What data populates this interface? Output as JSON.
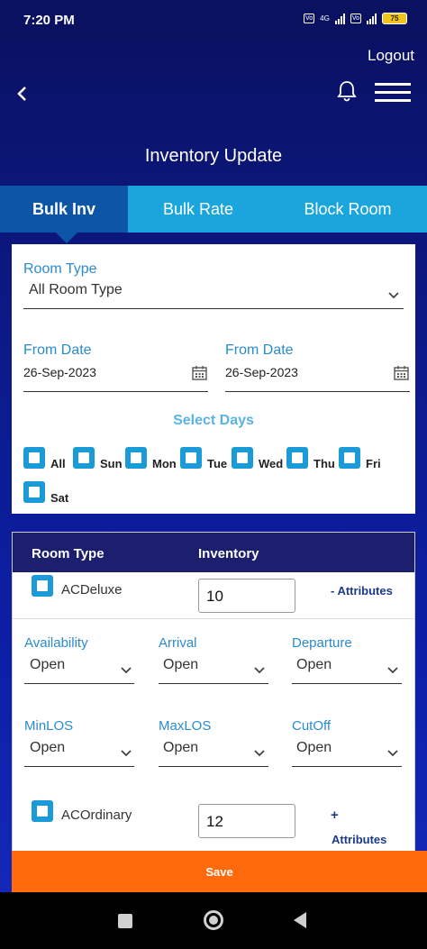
{
  "status_bar": {
    "time": "7:20 PM",
    "network": "4G",
    "battery": "75"
  },
  "header": {
    "logout_label": "Logout",
    "title": "Inventory Update"
  },
  "tabs": [
    {
      "label": "Bulk Inv",
      "active": true
    },
    {
      "label": "Bulk Rate",
      "active": false
    },
    {
      "label": "Block Room",
      "active": false
    }
  ],
  "filters": {
    "room_type_label": "Room Type",
    "room_type_value": "All Room Type",
    "from_date_label": "From Date",
    "from_date_value": "26-Sep-2023",
    "to_date_label": "From Date",
    "to_date_value": "26-Sep-2023",
    "select_days_label": "Select Days",
    "days": [
      "All",
      "Sun",
      "Mon",
      "Tue",
      "Wed",
      "Thu",
      "Fri",
      "Sat"
    ]
  },
  "table": {
    "headers": {
      "room_type": "Room Type",
      "inventory": "Inventory"
    },
    "rows": [
      {
        "name": "ACDeluxe",
        "inventory": "10",
        "attributes_label": "- Attributes",
        "attributes": {
          "availability": {
            "label": "Availability",
            "value": "Open"
          },
          "arrival": {
            "label": "Arrival",
            "value": "Open"
          },
          "departure": {
            "label": "Departure",
            "value": "Open"
          },
          "minlos": {
            "label": "MinLOS",
            "value": "Open"
          },
          "maxlos": {
            "label": "MaxLOS",
            "value": "Open"
          },
          "cutoff": {
            "label": "CutOff",
            "value": "Open"
          }
        }
      },
      {
        "name": "ACOrdinary",
        "inventory": "12",
        "attributes_plus": "+",
        "attributes_label": "Attributes"
      }
    ]
  },
  "save_label": "Save",
  "colors": {
    "accent": "#1a9ad6",
    "header_bg": "#1c1e6e",
    "save": "#ff6a0d",
    "active_tab": "#0d56a6"
  }
}
